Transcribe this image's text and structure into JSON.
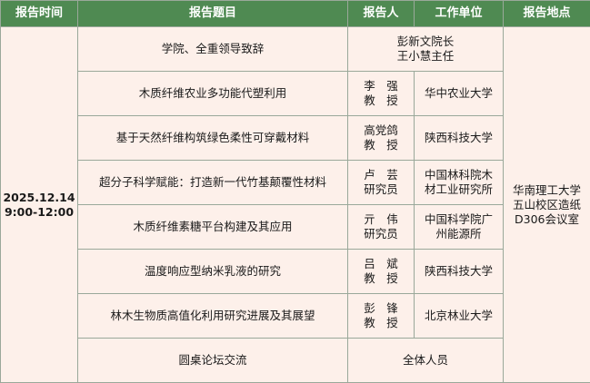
{
  "headers": {
    "time": "报告时间",
    "topic": "报告题目",
    "speaker": "报告人",
    "unit": "工作单位",
    "venue": "报告地点"
  },
  "time": {
    "date": "2025.12.14",
    "range": "9:00-12:00"
  },
  "venue": {
    "line1": "华南理工大学",
    "line2": "五山校区造纸",
    "line3": "D306会议室"
  },
  "rows": [
    {
      "topic": "学院、全重领导致辞",
      "speaker_line1": "彭新文院长",
      "speaker_line2": "王小慧主任",
      "unit_line1": "",
      "unit_line2": ""
    },
    {
      "topic": "木质纤维农业多功能代塑利用",
      "speaker_line1": "李　强",
      "speaker_line2": "教　授",
      "unit_line1": "华中农业大学",
      "unit_line2": ""
    },
    {
      "topic": "基于天然纤维构筑绿色柔性可穿戴材料",
      "speaker_line1": "高党鸽",
      "speaker_line2": "教　授",
      "unit_line1": "陕西科技大学",
      "unit_line2": ""
    },
    {
      "topic": "超分子科学赋能：打造新一代竹基颠覆性材料",
      "speaker_line1": "卢　芸",
      "speaker_line2": "研究员",
      "unit_line1": "中国林科院木",
      "unit_line2": "材工业研究所"
    },
    {
      "topic": "木质纤维素糖平台构建及其应用",
      "speaker_line1": "亓　伟",
      "speaker_line2": "研究员",
      "unit_line1": "中国科学院广",
      "unit_line2": "州能源所"
    },
    {
      "topic": "温度响应型纳米乳液的研究",
      "speaker_line1": "吕　斌",
      "speaker_line2": "教　授",
      "unit_line1": "陕西科技大学",
      "unit_line2": ""
    },
    {
      "topic": "林木生物质高值化利用研究进展及其展望",
      "speaker_line1": "彭　锋",
      "speaker_line2": "教　授",
      "unit_line1": "北京林业大学",
      "unit_line2": ""
    },
    {
      "topic": "圆桌论坛交流",
      "speaker_line1": "全体人员",
      "speaker_line2": "",
      "unit_line1": "",
      "unit_line2": ""
    }
  ]
}
